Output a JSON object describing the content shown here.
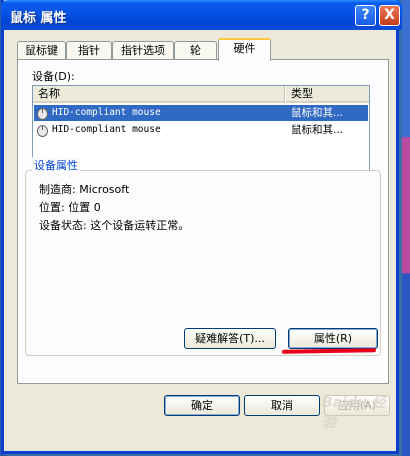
{
  "window": {
    "title": "鼠标 属性",
    "help_glyph": "?",
    "close_glyph": "X"
  },
  "tabs": [
    "鼠标键",
    "指针",
    "指针选项",
    "轮",
    "硬件"
  ],
  "devices": {
    "label": "设备(D):",
    "columns": [
      "名称",
      "类型"
    ],
    "rows": [
      {
        "name": "HID-compliant mouse",
        "type": "鼠标和其...",
        "selected": true
      },
      {
        "name": "HID-compliant mouse",
        "type": "鼠标和其...",
        "selected": false
      }
    ]
  },
  "properties": {
    "title": "设备属性",
    "manufacturer": "制造商: Microsoft",
    "location": "位置: 位置 0",
    "status": "设备状态: 这个设备运转正常。",
    "troubleshoot_label": "疑难解答(T)...",
    "properties_label": "属性(R)"
  },
  "footer": {
    "ok_label": "确定",
    "cancel_label": "取消",
    "apply_label": "应用(A)"
  },
  "watermark": "Baidu 经验",
  "colors": {
    "title_bar": "#0552e4",
    "selection": "#316ac5",
    "annotation": "#e8001b",
    "group_title": "#0046d5"
  }
}
